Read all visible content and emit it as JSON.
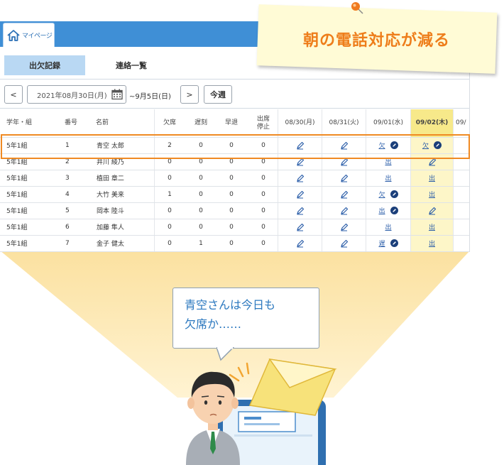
{
  "app": {
    "mypage_label": "マイページ",
    "tabs": [
      {
        "label": "出欠記録",
        "active": true
      },
      {
        "label": "連絡一覧",
        "active": false
      }
    ],
    "toolbar": {
      "prev_label": "<",
      "date_value": "2021年08月30日(月)",
      "range_end": "~9月5日(日)",
      "next_label": ">",
      "this_week_label": "今週"
    },
    "table": {
      "headers": {
        "class": "学年・組",
        "number": "番号",
        "name": "名前",
        "absent": "欠席",
        "late": "遅刻",
        "early": "早退",
        "suspend_line1": "出席",
        "suspend_line2": "停止",
        "d1": "08/30(月)",
        "d2": "08/31(火)",
        "d3": "09/01(水)",
        "d4": "09/02(木)",
        "d5": "09/"
      },
      "rows": [
        {
          "cls": "5年1組",
          "num": "1",
          "name": "青空 太郎",
          "absent": "2",
          "late": "0",
          "early": "0",
          "stop": "0",
          "d3": "欠",
          "d3_badge": true,
          "d4": "欠",
          "d4_badge": true
        },
        {
          "cls": "5年1組",
          "num": "2",
          "name": "井川 綾乃",
          "absent": "0",
          "late": "0",
          "early": "0",
          "stop": "0",
          "d3": "出",
          "d3_badge": false,
          "d4": "",
          "d4_badge": false
        },
        {
          "cls": "5年1組",
          "num": "3",
          "name": "植田 章二",
          "absent": "0",
          "late": "0",
          "early": "0",
          "stop": "0",
          "d3": "出",
          "d3_badge": false,
          "d4": "出",
          "d4_badge": false
        },
        {
          "cls": "5年1組",
          "num": "4",
          "name": "大竹 美来",
          "absent": "1",
          "late": "0",
          "early": "0",
          "stop": "0",
          "d3": "欠",
          "d3_badge": true,
          "d4": "出",
          "d4_badge": false
        },
        {
          "cls": "5年1組",
          "num": "5",
          "name": "岡本 陸斗",
          "absent": "0",
          "late": "0",
          "early": "0",
          "stop": "0",
          "d3": "出",
          "d3_badge": true,
          "d4": "",
          "d4_badge": false
        },
        {
          "cls": "5年1組",
          "num": "6",
          "name": "加藤 隼人",
          "absent": "0",
          "late": "0",
          "early": "0",
          "stop": "0",
          "d3": "出",
          "d3_badge": false,
          "d4": "出",
          "d4_badge": false
        },
        {
          "cls": "5年1組",
          "num": "7",
          "name": "金子 健太",
          "absent": "0",
          "late": "1",
          "early": "0",
          "stop": "0",
          "d3": "遅",
          "d3_badge": true,
          "d4": "出",
          "d4_badge": false
        }
      ]
    }
  },
  "callout": {
    "headline": "朝の電話対応が減る",
    "speech_line1": "青空さんは今日も",
    "speech_line2": "欠席か……"
  },
  "colors": {
    "accent_blue": "#3f8fd6",
    "highlight_orange": "#ef8a23",
    "today_column": "#fdf6c8",
    "funnel": "#fbe3a6"
  },
  "icons": [
    "home-icon",
    "calendar-icon",
    "pen-icon",
    "badge-icon",
    "pin-icon",
    "envelope-icon"
  ]
}
